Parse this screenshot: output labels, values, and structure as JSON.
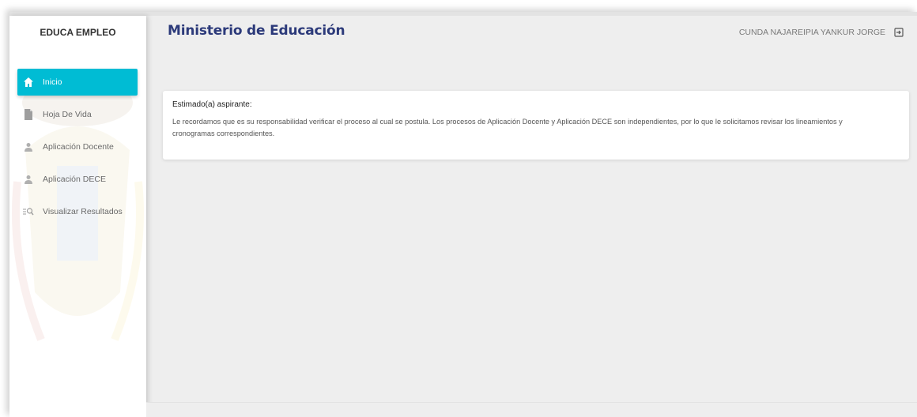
{
  "sidebar": {
    "brand": "EDUCA EMPLEO",
    "items": [
      {
        "label": "Inicio",
        "icon": "home-icon",
        "active": true
      },
      {
        "label": "Hoja De Vida",
        "icon": "document-icon",
        "active": false
      },
      {
        "label": "Aplicación Docente",
        "icon": "person-icon",
        "active": false
      },
      {
        "label": "Aplicación DECE",
        "icon": "person-icon",
        "active": false
      },
      {
        "label": "Visualizar Resultados",
        "icon": "list-search-icon",
        "active": false
      }
    ]
  },
  "header": {
    "title": "Ministerio de Educación",
    "user_name": "CUNDA NAJAREIPIA YANKUR JORGE",
    "logout_icon": "logout-icon"
  },
  "notice": {
    "greeting": "Estimado(a) aspirante:",
    "message": "Le recordamos que es su responsabilidad verificar el proceso al cual se postula. Los procesos de Aplicación Docente y Aplicación DECE son independientes, por lo que le solicitamos revisar los lineamientos y cronogramas correspondientes."
  },
  "colors": {
    "accent": "#00bcd4",
    "title": "#2c3a7a",
    "background": "#eeeeee"
  }
}
